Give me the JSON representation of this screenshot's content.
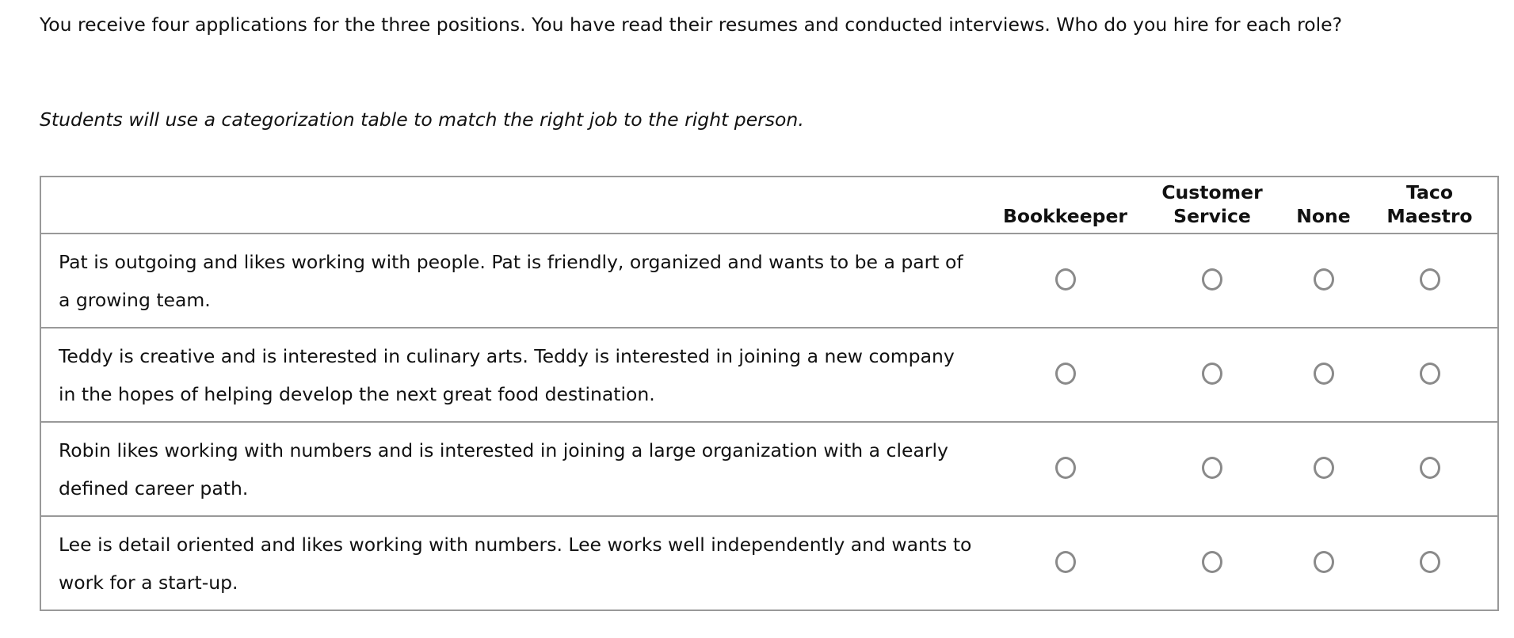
{
  "question": {
    "prompt": "You receive four applications for the three positions. You have read their resumes and conducted interviews. Who do you hire for each role?",
    "instruction": "Students will use a categorization table to match the right job to the right person."
  },
  "table": {
    "header_blank": "",
    "columns": [
      {
        "line1": "",
        "line2": "Bookkeeper"
      },
      {
        "line1": "Customer",
        "line2": "Service"
      },
      {
        "line1": "",
        "line2": "None"
      },
      {
        "line1": "Taco",
        "line2": "Maestro"
      }
    ],
    "rows": [
      {
        "description": "Pat is outgoing and likes working with people. Pat is friendly, organized and wants to be a part of a growing team.",
        "selected": null
      },
      {
        "description": "Teddy is creative and is interested in culinary arts. Teddy is interested in joining a new company in the hopes of helping develop the next great food destination.",
        "selected": null
      },
      {
        "description": "Robin likes working with numbers and is interested in joining a large organization with a clearly defined career path.",
        "selected": null
      },
      {
        "description": "Lee is detail oriented and likes working with numbers. Lee works well independently and wants to work for a start-up.",
        "selected": null
      }
    ]
  },
  "colors": {
    "border": "#999999",
    "radio_border": "#8a8a8a",
    "text": "#111111"
  }
}
